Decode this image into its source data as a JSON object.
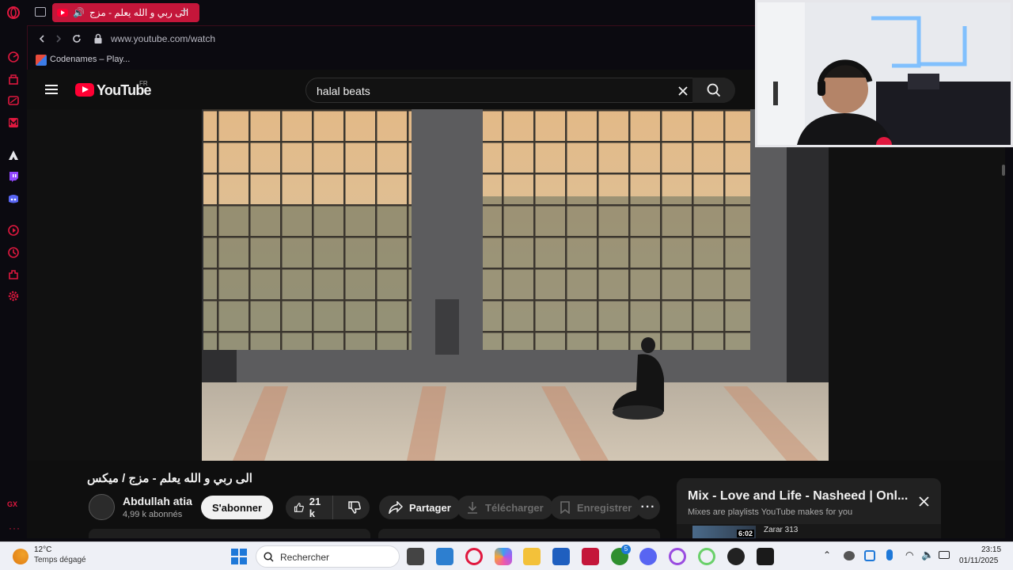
{
  "browser": {
    "active_tab_title": "الى ربي و الله يعلم - مزج",
    "url": "www.youtube.com/watch",
    "bookmark_label": "Codenames – Play..."
  },
  "youtube": {
    "logo_text": "YouTube",
    "region": "FR",
    "search_value": "halal beats",
    "video_title": "الى ربي و الله يعلم - مزج / ميكس",
    "channel_name": "Abdullah atia",
    "subscribers": "4,99 k abonnés",
    "subscribe_label": "S'abonner",
    "like_count": "21 k",
    "share_label": "Partager",
    "download_label": "Télécharger",
    "save_label": "Enregistrer"
  },
  "mix": {
    "title": "Mix - Love and Life - Nasheed | Onl...",
    "subtitle": "Mixes are playlists YouTube makes for you",
    "next_item": "Zarar 313",
    "duration": "6:02"
  },
  "taskbar": {
    "temperature": "12°C",
    "weather": "Temps dégagé",
    "search_placeholder": "Rechercher",
    "time": "23:15",
    "date": "01/11/2025",
    "xbox_badge": "5"
  },
  "sidebar_badge": "GX",
  "colors": {
    "opera_red": "#c4163a",
    "youtube_red": "#ff0033"
  }
}
